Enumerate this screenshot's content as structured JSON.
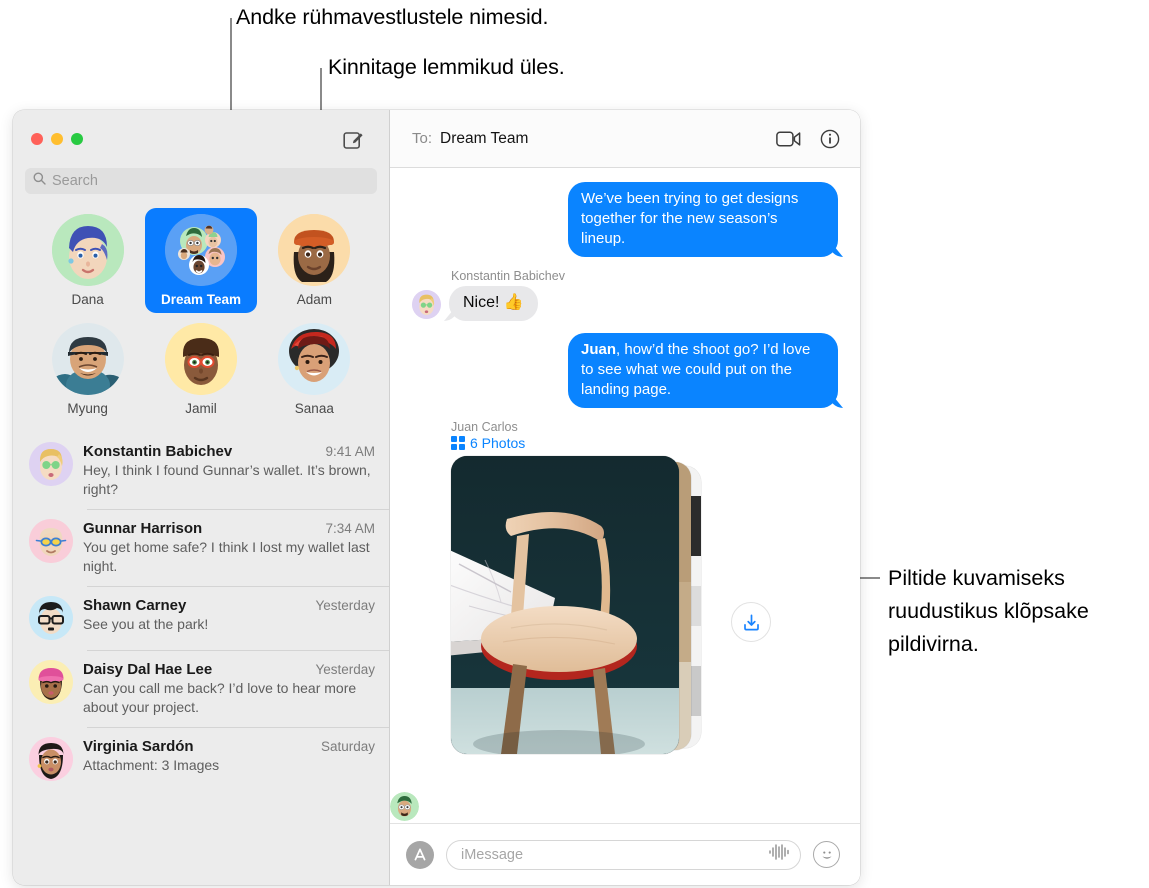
{
  "callouts": {
    "top_left": "Andke rühmavestlustele nimesid.",
    "top_right": "Kinnitage lemmikud üles.",
    "right": "Piltide kuvamiseks ruudustikus klõpsake pildivirna."
  },
  "colors": {
    "accent_blue": "#0a84ff",
    "selected_pin": "#0a7cff",
    "incoming_bubble": "#e8e8ea",
    "sidebar_bg": "#ececec",
    "traffic_red": "#ff6159",
    "traffic_yellow": "#ffbe2f",
    "traffic_green": "#28ca42"
  },
  "sidebar": {
    "compose_icon": "compose-icon",
    "search": {
      "placeholder": "Search",
      "icon": "search-icon"
    },
    "pinned": [
      {
        "label": "Dana",
        "avatar": "memoji-blue-hair",
        "selected": false
      },
      {
        "label": "Dream Team",
        "avatar": "group-memoji",
        "selected": true
      },
      {
        "label": "Adam",
        "avatar": "memoji-red-beret",
        "selected": false
      },
      {
        "label": "Myung",
        "avatar": "photo-myung",
        "selected": false
      },
      {
        "label": "Jamil",
        "avatar": "memoji-glasses",
        "selected": false
      },
      {
        "label": "Sanaa",
        "avatar": "photo-sanaa",
        "selected": false
      }
    ],
    "conversations": [
      {
        "name": "Konstantin Babichev",
        "time": "9:41 AM",
        "preview": "Hey, I think I found Gunnar’s wallet. It’s brown, right?",
        "avatar": "memoji-konstantin"
      },
      {
        "name": "Gunnar Harrison",
        "time": "7:34 AM",
        "preview": "You get home safe? I think I lost my wallet last night.",
        "avatar": "memoji-gunnar"
      },
      {
        "name": "Shawn Carney",
        "time": "Yesterday",
        "preview": "See you at the park!",
        "avatar": "memoji-shawn"
      },
      {
        "name": "Daisy Dal Hae Lee",
        "time": "Yesterday",
        "preview": "Can you call me back? I’d love to hear more about your project.",
        "avatar": "memoji-daisy"
      },
      {
        "name": "Virginia Sardón",
        "time": "Saturday",
        "preview": "Attachment: 3 Images",
        "avatar": "memoji-virginia"
      }
    ]
  },
  "pane": {
    "header": {
      "to_label": "To:",
      "to_value": "Dream Team",
      "facetime_icon": "video-camera-icon",
      "info_icon": "info-circle-icon"
    },
    "messages": [
      {
        "direction": "out",
        "text": "We’ve been trying to get designs together for the new season’s lineup."
      },
      {
        "direction": "in",
        "sender": "Konstantin Babichev",
        "text": "Nice!  👍",
        "avatar": "memoji-konstantin"
      },
      {
        "direction": "out",
        "text_bold": "Juan",
        "text": ", how’d the shoot go? I’d love to see what we could put on the landing page."
      }
    ],
    "attachment": {
      "sender": "Juan Carlos",
      "count_label": "6 Photos",
      "grid_icon": "grid-icon",
      "save_icon": "save-download-icon",
      "avatar": "memoji-juan"
    },
    "compose": {
      "appstore_icon": "app-store-icon",
      "placeholder": "iMessage",
      "audio_icon": "audio-waveform-icon",
      "emoji_icon": "emoji-smiley-icon"
    }
  }
}
